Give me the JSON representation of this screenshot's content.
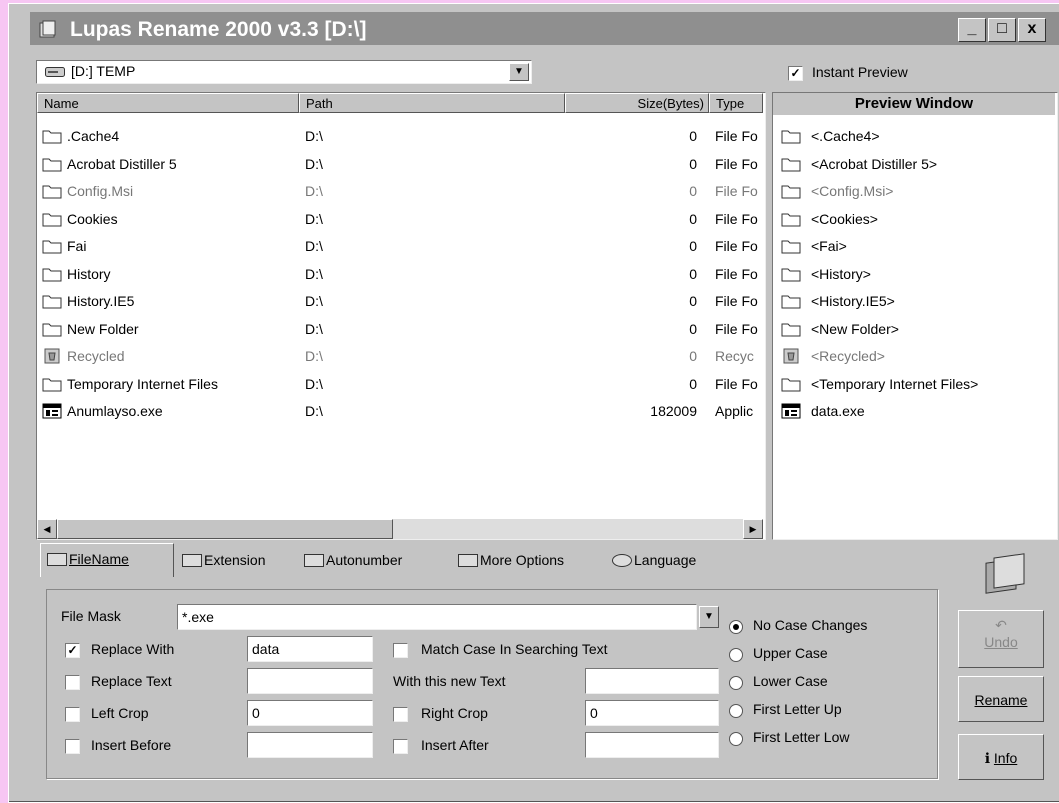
{
  "window": {
    "title": "Lupas Rename 2000 v3.3  [D:\\]",
    "controls": [
      "_",
      "□",
      "x"
    ]
  },
  "drive_combo": {
    "value": "[D:] TEMP"
  },
  "file_list": {
    "columns": [
      "Name",
      "Path",
      "Size(Bytes)",
      "Type"
    ],
    "rows": [
      {
        "name": ".Cache4",
        "path": "D:\\",
        "size": "0",
        "type": "File Fo",
        "icon": "folder-icon",
        "dim": false
      },
      {
        "name": "Acrobat Distiller 5",
        "path": "D:\\",
        "size": "0",
        "type": "File Fo",
        "icon": "folder-icon",
        "dim": false
      },
      {
        "name": "Config.Msi",
        "path": "D:\\",
        "size": "0",
        "type": "File Fo",
        "icon": "folder-icon",
        "dim": true
      },
      {
        "name": "Cookies",
        "path": "D:\\",
        "size": "0",
        "type": "File Fo",
        "icon": "folder-icon",
        "dim": false
      },
      {
        "name": "Fai",
        "path": "D:\\",
        "size": "0",
        "type": "File Fo",
        "icon": "folder-icon",
        "dim": false
      },
      {
        "name": "History",
        "path": "D:\\",
        "size": "0",
        "type": "File Fo",
        "icon": "folder-icon",
        "dim": false
      },
      {
        "name": "History.IE5",
        "path": "D:\\",
        "size": "0",
        "type": "File Fo",
        "icon": "folder-icon",
        "dim": false
      },
      {
        "name": "New Folder",
        "path": "D:\\",
        "size": "0",
        "type": "File Fo",
        "icon": "folder-icon",
        "dim": false
      },
      {
        "name": "Recycled",
        "path": "D:\\",
        "size": "0",
        "type": "Recyc",
        "icon": "recycle-icon",
        "dim": true
      },
      {
        "name": "Temporary Internet Files",
        "path": "D:\\",
        "size": "0",
        "type": "File Fo",
        "icon": "folder-icon",
        "dim": false
      },
      {
        "name": "Anumlayso.exe",
        "path": "D:\\",
        "size": "182009",
        "type": "Applic",
        "icon": "exe-icon",
        "dim": false
      }
    ]
  },
  "preview": {
    "instant_label": "Instant Preview",
    "instant_checked": true,
    "title": "Preview Window",
    "items": [
      {
        "text": "<.Cache4>",
        "icon": "folder-icon",
        "dim": false
      },
      {
        "text": "<Acrobat Distiller 5>",
        "icon": "folder-icon",
        "dim": false
      },
      {
        "text": "<Config.Msi>",
        "icon": "folder-icon",
        "dim": true
      },
      {
        "text": "<Cookies>",
        "icon": "folder-icon",
        "dim": false
      },
      {
        "text": "<Fai>",
        "icon": "folder-icon",
        "dim": false
      },
      {
        "text": "<History>",
        "icon": "folder-icon",
        "dim": false
      },
      {
        "text": "<History.IE5>",
        "icon": "folder-icon",
        "dim": false
      },
      {
        "text": "<New Folder>",
        "icon": "folder-icon",
        "dim": false
      },
      {
        "text": "<Recycled>",
        "icon": "recycle-icon",
        "dim": true
      },
      {
        "text": "<Temporary Internet Files>",
        "icon": "folder-icon",
        "dim": false
      },
      {
        "text": "data.exe",
        "icon": "exe-icon",
        "dim": false
      }
    ]
  },
  "tabs": [
    {
      "label": "FileName",
      "active": true
    },
    {
      "label": "Extension",
      "active": false
    },
    {
      "label": "Autonumber",
      "active": false
    },
    {
      "label": "More Options",
      "active": false
    },
    {
      "label": "Language",
      "active": false
    }
  ],
  "form": {
    "file_mask_label": "File Mask",
    "file_mask_value": "*.exe",
    "replace_with_label": "Replace With",
    "replace_with_checked": true,
    "replace_with_value": "data",
    "match_case_label": "Match Case In Searching Text",
    "replace_text_label": "Replace Text",
    "replace_text_value": "",
    "with_new_text_label": "With this new Text",
    "with_new_text_value": "",
    "left_crop_label": "Left Crop",
    "left_crop_value": "0",
    "right_crop_label": "Right Crop",
    "right_crop_value": "0",
    "insert_before_label": "Insert Before",
    "insert_before_value": "",
    "insert_after_label": "Insert After",
    "insert_after_value": ""
  },
  "case_options": [
    {
      "label": "No Case Changes",
      "selected": true
    },
    {
      "label": "Upper Case",
      "selected": false
    },
    {
      "label": "Lower Case",
      "selected": false
    },
    {
      "label": "First Letter Up",
      "selected": false
    },
    {
      "label": "First Letter Low",
      "selected": false
    }
  ],
  "side_buttons": {
    "undo": "Undo",
    "rename": "Rename",
    "info": "Info"
  }
}
